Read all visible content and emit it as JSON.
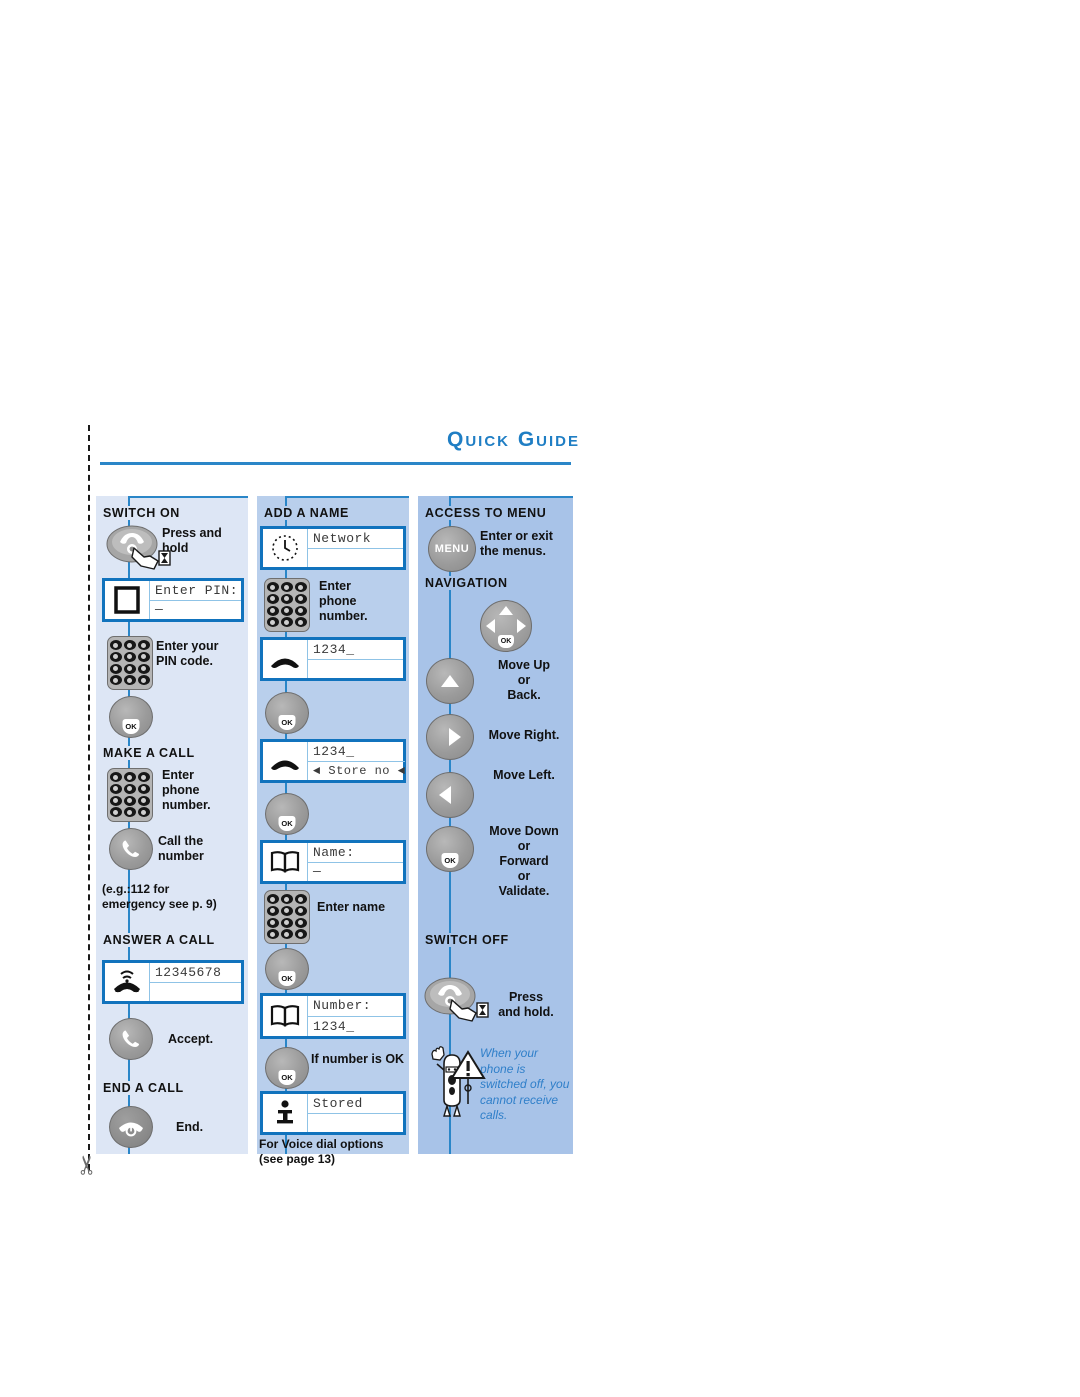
{
  "page": {
    "title": "Quick Guide"
  },
  "icons": {
    "scissors": "scissors-icon"
  },
  "columns": [
    {
      "id": "switch-on",
      "bg": "#dde6f5",
      "sections": [
        {
          "heading": "SWITCH ON"
        },
        {
          "heading": "MAKE A CALL"
        },
        {
          "heading": "ANSWER A CALL"
        },
        {
          "heading": "END A CALL"
        }
      ],
      "captions": {
        "press_and_hold": "Press and\nhold",
        "enter_your_pin_code": "Enter your\nPIN code.",
        "enter_phone_number": "Enter\nphone\nnumber.",
        "call_the_number": "Call  the\nnumber",
        "emergency_note": "(e.g.:112 for\nemergency see p. 9)",
        "accept": "Accept.",
        "end": "End."
      },
      "displays": {
        "enter_pin": {
          "line1": "Enter PIN:",
          "line2": "—",
          "icon": "sim-card-icon"
        },
        "incoming_call": {
          "line1": "12345678",
          "line2": "",
          "icon": "incoming-call-icon"
        }
      }
    },
    {
      "id": "add-a-name",
      "bg": "#b9cfec",
      "sections": [
        {
          "heading": "ADD A NAME"
        }
      ],
      "captions": {
        "enter_phone_number": "Enter\nphone\nnumber.",
        "enter_name": "Enter name",
        "if_number_is_ok": "If number is OK",
        "voice_dial_note": "For Voice dial options\n(see page 13)"
      },
      "displays": {
        "network": {
          "line1": "Network",
          "line2": "",
          "icon": "clock-icon"
        },
        "dialed": {
          "line1": "1234_",
          "line2": "",
          "icon": "handset-icon"
        },
        "store_no": {
          "line1": "1234_",
          "line2": "◄ Store no ◄",
          "icon": "handset-icon"
        },
        "name": {
          "line1": "Name:",
          "line2": "—",
          "icon": "phonebook-icon"
        },
        "number": {
          "line1": "Number:",
          "line2": "1234_",
          "icon": "phonebook-icon"
        },
        "stored": {
          "line1": "Stored",
          "line2": "",
          "icon": "info-icon"
        }
      }
    },
    {
      "id": "access-menu",
      "bg": "#a8c3e8",
      "sections": [
        {
          "heading": "ACCESS TO MENU"
        },
        {
          "heading": "NAVIGATION"
        },
        {
          "heading": "SWITCH OFF"
        }
      ],
      "captions": {
        "enter_or_exit": "Enter or exit\nthe menus.",
        "move_up": "Move Up\nor\nBack.",
        "move_right": "Move Right.",
        "move_left": "Move Left.",
        "move_down": "Move Down\nor\nForward\nor\nValidate.",
        "press_and_hold": "Press\nand hold."
      },
      "keys": {
        "menu_label": "MENU",
        "ok_label": "OK"
      },
      "tip": "When your\nphone is\nswitched off, you\ncannot receive\ncalls."
    }
  ],
  "colors": {
    "title_blue": "#1f7ec4",
    "rule_blue": "#2a86c8",
    "display_border": "#1173bd",
    "tip_text": "#2f7fc9"
  }
}
